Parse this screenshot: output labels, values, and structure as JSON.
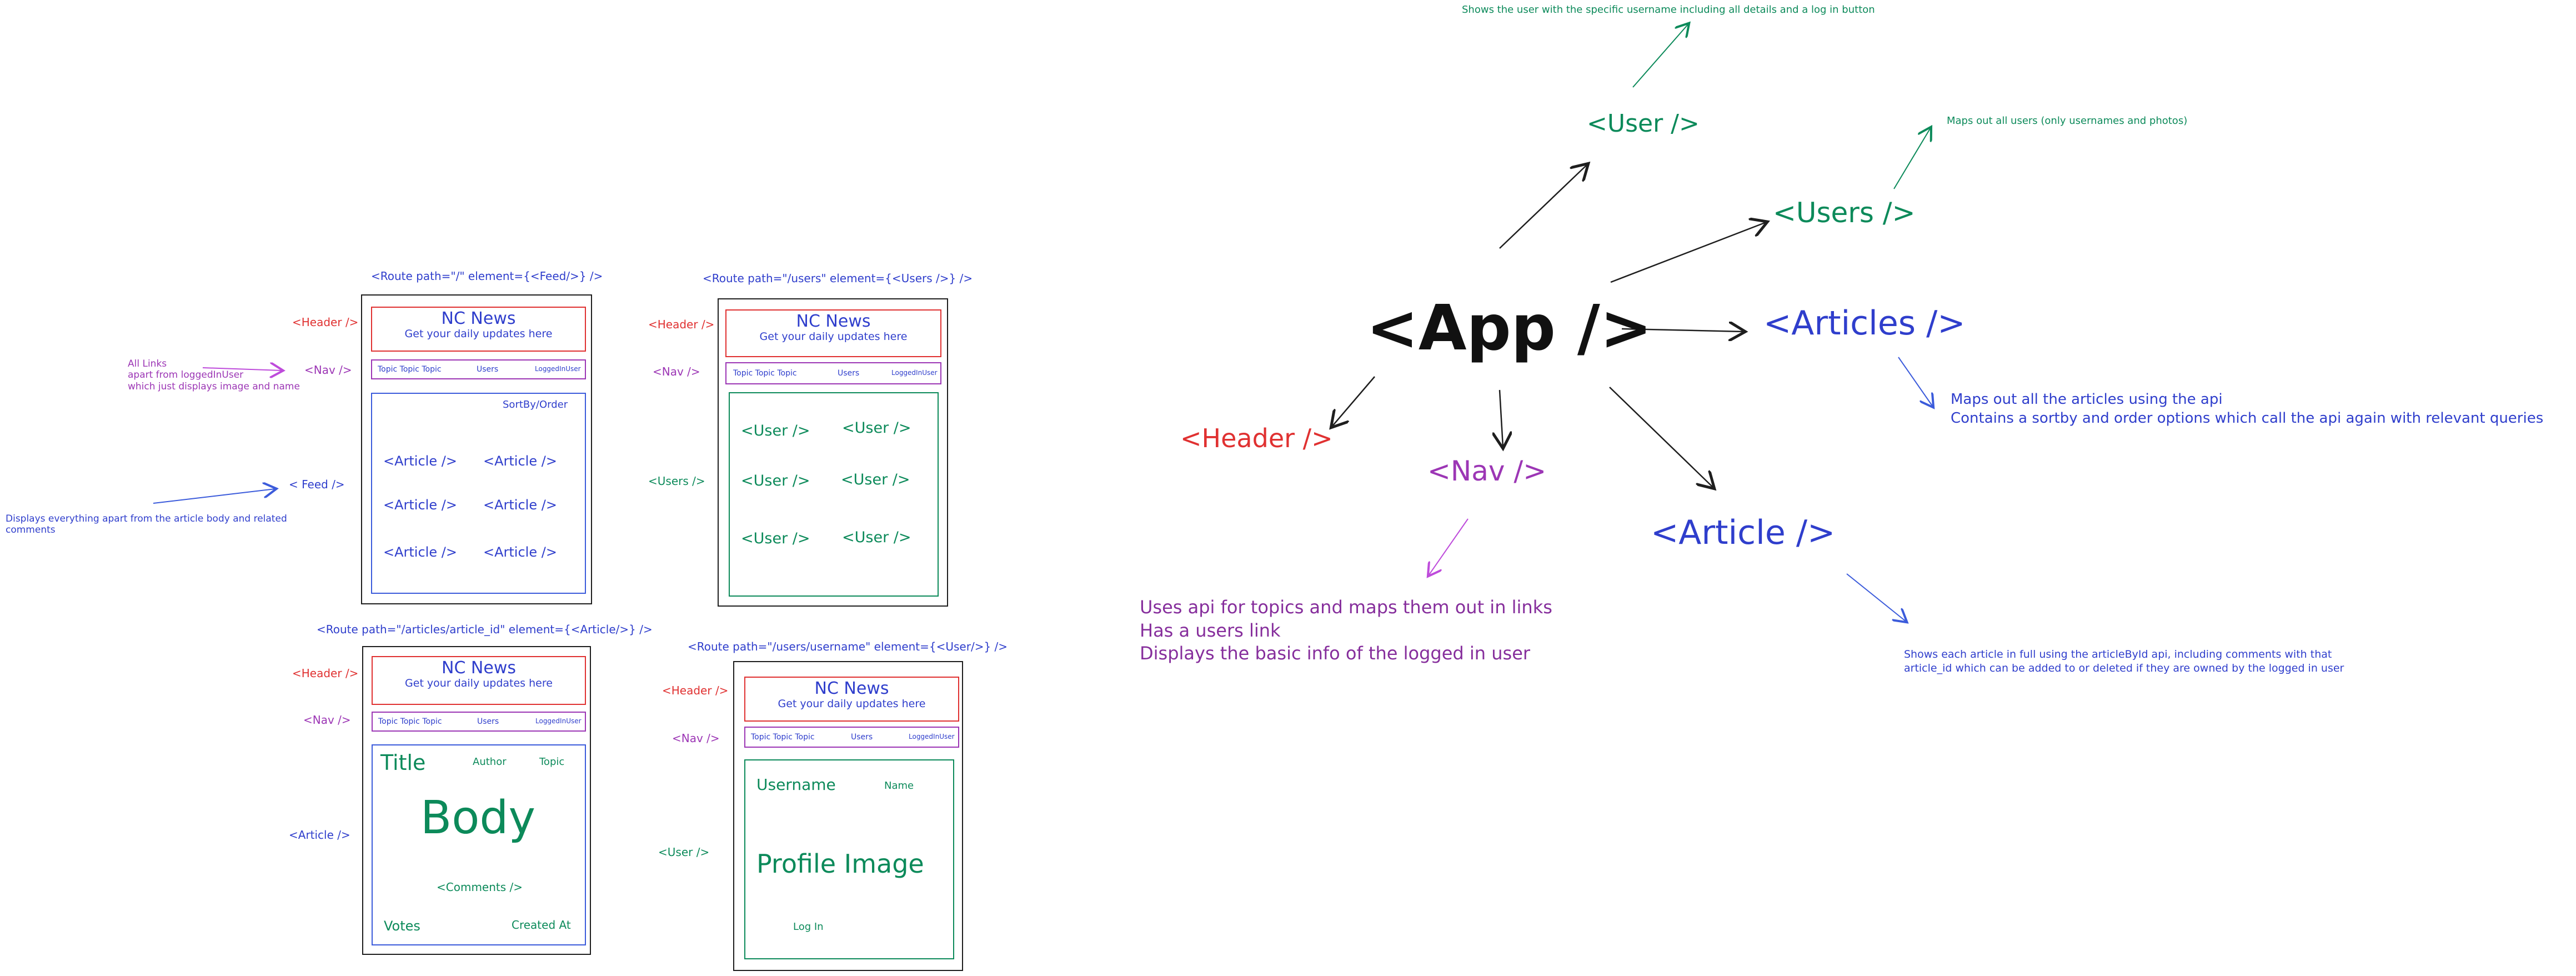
{
  "colors": {
    "red": "#e03131",
    "purple": "#9c36b5",
    "blue": "#2f3ecc",
    "green": "#0c8a5a",
    "black": "#111111"
  },
  "wire_feed": {
    "route": "<Route path=\"/\" element={<Feed/>} />",
    "header_label": "<Header />",
    "nav_label": "<Nav />",
    "feed_label": "< Feed />",
    "header_title": "NC News",
    "header_sub": "Get your daily updates here",
    "nav_topics": "Topic Topic Topic",
    "nav_users": "Users",
    "nav_logged": "LoggedInUser",
    "sort": "SortBy/Order",
    "articles": [
      "<Article />",
      "<Article />",
      "<Article />",
      "<Article />",
      "<Article />",
      "<Article />"
    ],
    "note_links": "All Links\napart from loggedInUser\nwhich just displays image and name",
    "note_feed": "Displays everything apart from the article body and related\ncomments"
  },
  "wire_users": {
    "route": "<Route path=\"/users\" element={<Users />} />",
    "header_label": "<Header />",
    "nav_label": "<Nav />",
    "users_label": "<Users />",
    "header_title": "NC News",
    "header_sub": "Get your daily updates here",
    "nav_topics": "Topic Topic Topic",
    "nav_users": "Users",
    "nav_logged": "LoggedInUser",
    "users": [
      "<User />",
      "<User />",
      "<User />",
      "<User />",
      "<User />",
      "<User />"
    ]
  },
  "wire_article": {
    "route": "<Route path=\"/articles/article_id\" element={<Article/>} />",
    "header_label": "<Header />",
    "nav_label": "<Nav />",
    "article_label": "<Article />",
    "header_title": "NC News",
    "header_sub": "Get your daily updates here",
    "nav_topics": "Topic Topic Topic",
    "nav_users": "Users",
    "nav_logged": "LoggedInUser",
    "title": "Title",
    "author": "Author",
    "topic": "Topic",
    "body": "Body",
    "comments": "<Comments />",
    "votes": "Votes",
    "created": "Created At"
  },
  "wire_user": {
    "route": "<Route path=\"/users/username\" element={<User/>} />",
    "header_label": "<Header />",
    "nav_label": "<Nav />",
    "user_label": "<User />",
    "header_title": "NC News",
    "header_sub": "Get your daily updates here",
    "nav_topics": "Topic Topic Topic",
    "nav_users": "Users",
    "nav_logged": "LoggedInUser",
    "username": "Username",
    "name": "Name",
    "profile_image": "Profile Image",
    "login": "Log In"
  },
  "tree": {
    "app": "<App />",
    "header": "<Header />",
    "nav": "<Nav />",
    "article": "<Article />",
    "articles": "<Articles />",
    "users": "<Users />",
    "user": "<User />",
    "note_user": "Shows the user with the specific username including all details and a log in button",
    "note_users": "Maps out all users (only usernames and photos)",
    "note_articles": "Maps out all the articles using the api\nContains a sortby and order options which call the api again with relevant queries",
    "note_nav": "Uses api for topics and maps them out in links\nHas a users link\nDisplays the basic info of the logged in user",
    "note_article": "Shows each article in full using the articleById api, including comments with that\narticle_id which can be added to or deleted if they are owned by the logged in user"
  }
}
